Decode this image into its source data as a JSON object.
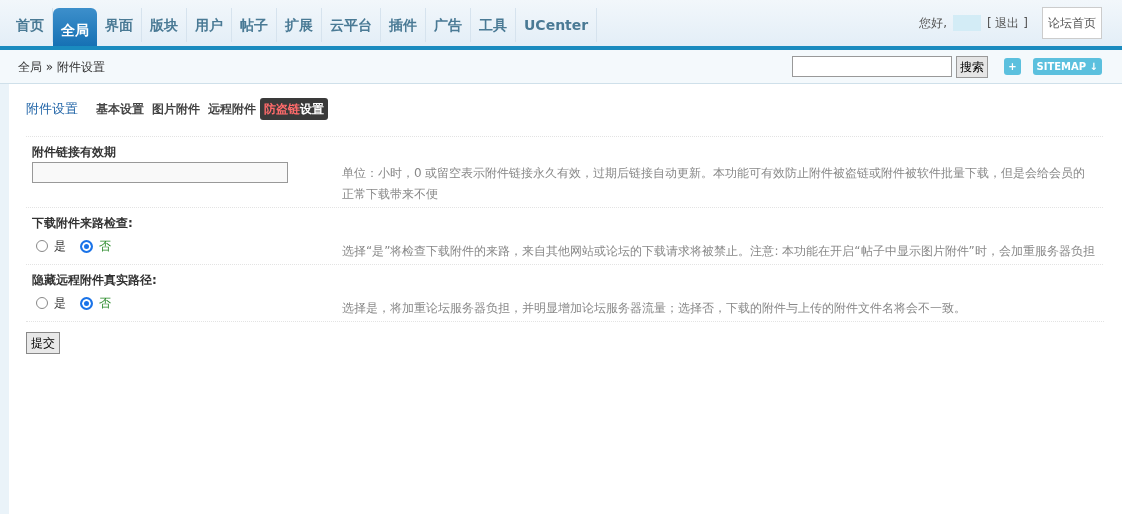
{
  "nav_tabs": [
    {
      "label": "首页",
      "selected": false
    },
    {
      "label": "全局",
      "selected": true
    },
    {
      "label": "界面",
      "selected": false
    },
    {
      "label": "版块",
      "selected": false
    },
    {
      "label": "用户",
      "selected": false
    },
    {
      "label": "帖子",
      "selected": false
    },
    {
      "label": "扩展",
      "selected": false
    },
    {
      "label": "云平台",
      "selected": false
    },
    {
      "label": "插件",
      "selected": false
    },
    {
      "label": "广告",
      "selected": false
    },
    {
      "label": "工具",
      "selected": false
    },
    {
      "label": "UCenter",
      "selected": false
    }
  ],
  "user_bar": {
    "greeting": "您好,",
    "logout": "[ 退出 ]",
    "home_button": "论坛首页"
  },
  "breadcrumb": "全局 » 附件设置",
  "search": {
    "button": "搜索"
  },
  "add_button": "+",
  "sitemap_button": "SITEMAP ↓",
  "page_title": "附件设置",
  "sub_tabs": [
    {
      "parts": [
        {
          "text": "基本设置",
          "kind": "plain"
        }
      ],
      "selected": false
    },
    {
      "parts": [
        {
          "text": "图片附件",
          "kind": "plain"
        }
      ],
      "selected": false
    },
    {
      "parts": [
        {
          "text": "远程附件",
          "kind": "plain"
        }
      ],
      "selected": false
    },
    {
      "parts": [
        {
          "text": "防盗链",
          "kind": "highlight"
        },
        {
          "text": "设置",
          "kind": "plain"
        }
      ],
      "selected": true
    }
  ],
  "settings": [
    {
      "label": "附件链接有效期",
      "kind": "text",
      "hint": "单位：小时，0 或留空表示附件链接永久有效，过期后链接自动更新。本功能可有效防止附件被盗链或附件被软件批量下载，但是会给会员的正常下载带来不便"
    },
    {
      "label": "下载附件来路检查:",
      "kind": "radio",
      "options": [
        {
          "label": "是",
          "selected": false
        },
        {
          "label": "否",
          "selected": true
        }
      ],
      "hint": "选择“是”将检查下载附件的来路，来自其他网站或论坛的下载请求将被禁止。注意: 本功能在开启“帖子中显示图片附件”时，会加重服务器负担"
    },
    {
      "label": "隐藏远程附件真实路径:",
      "kind": "radio",
      "options": [
        {
          "label": "是",
          "selected": false
        },
        {
          "label": "否",
          "selected": true
        }
      ],
      "hint": "选择是，将加重论坛服务器负担，并明显增加论坛服务器流量；选择否，下载的附件与上传的附件文件名将会不一致。"
    }
  ],
  "submit_button": "提交"
}
